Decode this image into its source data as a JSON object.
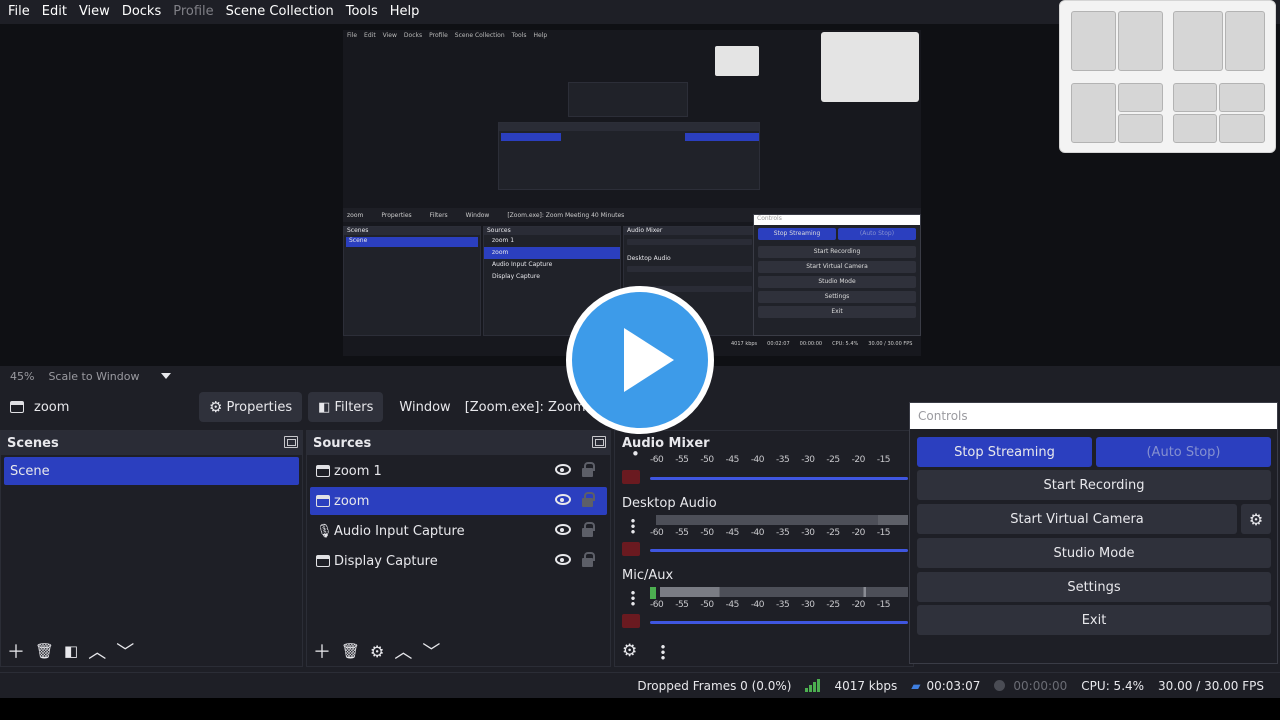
{
  "menu": [
    "File",
    "Edit",
    "View",
    "Docks",
    "Profile",
    "Scene Collection",
    "Tools",
    "Help"
  ],
  "zoom": {
    "percent": "45%",
    "mode": "Scale to Window"
  },
  "toolbar": {
    "source": "zoom",
    "properties": "Properties",
    "filters": "Filters",
    "window_label": "Window",
    "window_value": "[Zoom.exe]: Zoom Mee"
  },
  "scenes": {
    "title": "Scenes",
    "items": [
      "Scene"
    ]
  },
  "sources": {
    "title": "Sources",
    "items": [
      {
        "name": "zoom 1",
        "icon": "window-icon"
      },
      {
        "name": "zoom",
        "icon": "window-icon"
      },
      {
        "name": "Audio Input Capture",
        "icon": "mic-icon"
      },
      {
        "name": "Display Capture",
        "icon": "monitor-icon"
      }
    ]
  },
  "mixer": {
    "title": "Audio Mixer",
    "channels": [
      "Desktop Audio",
      "Mic/Aux"
    ],
    "ticks": [
      "-60",
      "-55",
      "-50",
      "-45",
      "-40",
      "-35",
      "-30",
      "-25",
      "-20",
      "-15"
    ]
  },
  "controls": {
    "title": "Controls",
    "stop_streaming": "Stop Streaming",
    "auto_stop": "(Auto Stop)",
    "start_recording": "Start Recording",
    "start_virtual_camera": "Start Virtual Camera",
    "studio_mode": "Studio Mode",
    "settings": "Settings",
    "exit": "Exit"
  },
  "status": {
    "dropped": "Dropped Frames 0 (0.0%)",
    "bitrate": "4017 kbps",
    "stream_time": "00:03:07",
    "rec_time": "00:00:00",
    "cpu": "CPU: 5.4%",
    "fps": "30.00 / 30.00 FPS"
  },
  "preview_mini": {
    "menu": [
      "File",
      "Edit",
      "View",
      "Docks",
      "Profile",
      "Scene Collection",
      "Tools",
      "Help"
    ],
    "source": "zoom",
    "properties": "Properties",
    "filters": "Filters",
    "window_label": "Window",
    "window_value": "[Zoom.exe]: Zoom Meeting 40 Minutes",
    "scenes_title": "Scenes",
    "scene": "Scene",
    "sources_title": "Sources",
    "sources": [
      "zoom 1",
      "zoom",
      "Audio Input Capture",
      "Display Capture"
    ],
    "mixer_title": "Audio Mixer",
    "desktop_audio": "Desktop Audio",
    "controls_title": "Controls",
    "buttons": [
      "Stop Streaming",
      "(Auto Stop)",
      "Start Recording",
      "Start Virtual Camera",
      "Studio Mode",
      "Settings",
      "Exit"
    ],
    "status_bitrate": "4017 kbps",
    "status_time": "00:02:07",
    "status_rec": "00:00:00",
    "status_cpu": "CPU: 5.4%",
    "status_fps": "30.00 / 30.00 FPS"
  },
  "colors": {
    "accent": "#2b3fbf",
    "background": "#1e1f26",
    "dock_header": "#2a2c36",
    "play": "#3d9be9"
  }
}
